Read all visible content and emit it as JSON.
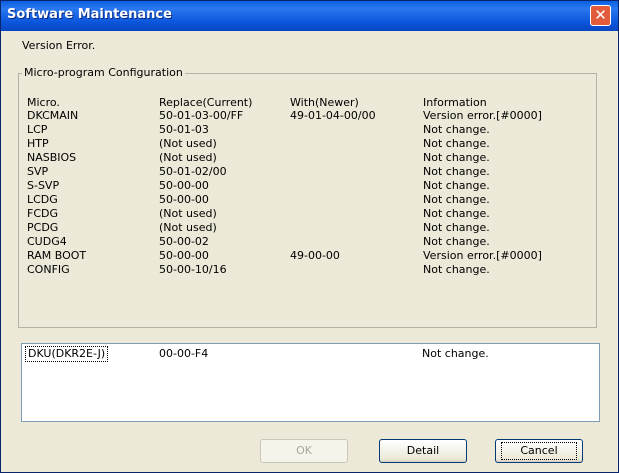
{
  "window": {
    "title": "Software Maintenance",
    "close_glyph": "✕"
  },
  "message": "Version Error.",
  "group": {
    "label": "Micro-program Configuration",
    "headers": [
      "Micro.",
      "Replace(Current)",
      "With(Newer)",
      "Information"
    ],
    "rows": [
      [
        "DKCMAIN",
        "50-01-03-00/FF",
        "49-01-04-00/00",
        "Version error.[#0000]"
      ],
      [
        "LCP",
        "50-01-03",
        "",
        "Not change."
      ],
      [
        "HTP",
        "(Not used)",
        "",
        "Not change."
      ],
      [
        "NASBIOS",
        "(Not used)",
        "",
        "Not change."
      ],
      [
        "SVP",
        "50-01-02/00",
        "",
        "Not change."
      ],
      [
        "S-SVP",
        "50-00-00",
        "",
        "Not change."
      ],
      [
        "LCDG",
        "50-00-00",
        "",
        "Not change."
      ],
      [
        "FCDG",
        "(Not used)",
        "",
        "Not change."
      ],
      [
        "PCDG",
        "(Not used)",
        "",
        "Not change."
      ],
      [
        "CUDG4",
        "50-00-02",
        "",
        "Not change."
      ],
      [
        "RAM BOOT",
        "50-00-00",
        "49-00-00",
        "Version error.[#0000]"
      ],
      [
        "CONFIG",
        "50-00-10/16",
        "",
        "Not change."
      ]
    ]
  },
  "drive_list": [
    [
      "DKU(DKR2E-J)",
      "00-00-F4",
      "",
      "Not change."
    ]
  ],
  "buttons": {
    "ok": "OK",
    "detail": "Detail",
    "cancel": "Cancel"
  },
  "colors": {
    "titlebar": "#0a5fe0",
    "close": "#e25b3a",
    "face": "#ece9d8"
  }
}
